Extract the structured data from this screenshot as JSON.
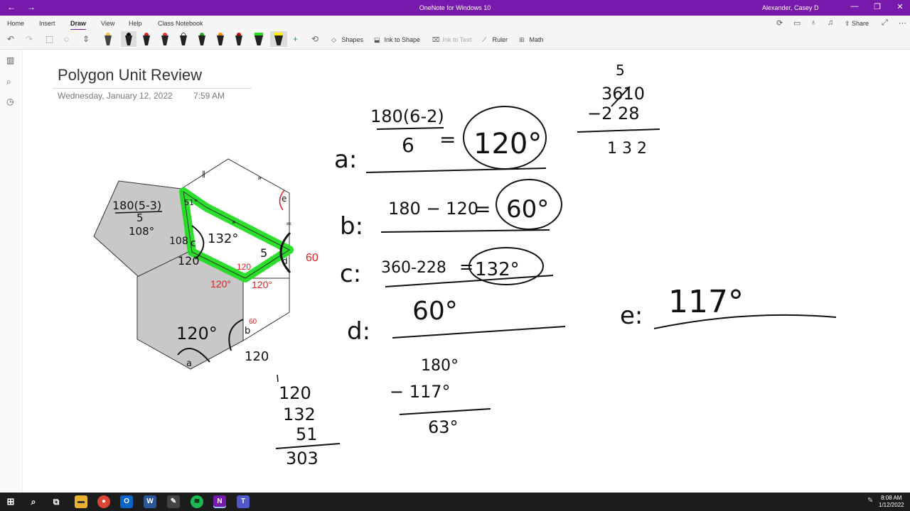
{
  "window": {
    "title": "OneNote for Windows 10",
    "user": "Alexander, Casey D",
    "back_icon": "←",
    "forward_icon": "→",
    "minimize": "—",
    "restore": "❐",
    "close": "✕"
  },
  "ribbon": {
    "tabs": [
      "Home",
      "Insert",
      "Draw",
      "View",
      "Help",
      "Class Notebook"
    ],
    "active_tab": "Draw",
    "share_label": "Share",
    "shapes_label": "Shapes",
    "ink_to_shape_label": "Ink to Shape",
    "ink_to_text_label": "Ink to Text",
    "ruler_label": "Ruler",
    "math_label": "Math"
  },
  "colors": {
    "brand": "#7719aa",
    "highlight": "#22dd22",
    "hexagon_fill": "#c8c8c8",
    "red_ink": "#dd2222"
  },
  "page": {
    "title": "Polygon Unit Review",
    "date": "Wednesday, January 12, 2022",
    "time": "7:59 AM"
  },
  "ink": {
    "a_label": "a:",
    "a_formula_top": "180(6-2)",
    "a_formula_bottom": "6",
    "a_eq": "=",
    "a_answer": "120°",
    "b_label": "b:",
    "b_expr": "180 − 120",
    "b_eq": "=",
    "b_answer": "60°",
    "c_label": "c:",
    "c_expr": "360-228",
    "c_eq": "=",
    "c_answer": "132°",
    "d_label": "d:",
    "d_answer": "60°",
    "e_label": "e:",
    "e_answer": "117°",
    "sub1_carry": "5",
    "sub1_top": "3610",
    "sub1_minus": "−2 28",
    "sub1_result": "1 3 2",
    "sum_1": "120",
    "sum_2": "132",
    "sum_3": "51",
    "sum_result": "303",
    "sub2_top": "180°",
    "sub2_minus": "− 117°",
    "sub2_result": "63°",
    "pent_formula_top": "180(5-3)",
    "pent_formula_bottom": "5",
    "pent_result": "108°",
    "lbl_51": "51°",
    "lbl_108": "108",
    "lbl_c": "c",
    "lbl_132": "132°",
    "lbl_120a": "120",
    "lbl_120_red1": "120",
    "lbl_120_red2": "120°",
    "lbl_120_red3": "120°",
    "lbl_5": "5",
    "lbl_d": "d",
    "lbl_60_red": "60",
    "lbl_e": "e",
    "lbl_120_hex": "120°",
    "lbl_a": "a",
    "lbl_b": "b",
    "lbl_60_small": "60",
    "lbl_120_bottom": "120"
  },
  "taskbar": {
    "time": "8:08 AM",
    "date": "1/12/2022",
    "apps": [
      "start-icon",
      "search-icon",
      "task-view-icon",
      "file-explorer-icon",
      "chrome-icon",
      "outlook-icon",
      "word-icon",
      "paint-icon",
      "spotify-icon",
      "onenote-icon",
      "teams-icon"
    ]
  }
}
